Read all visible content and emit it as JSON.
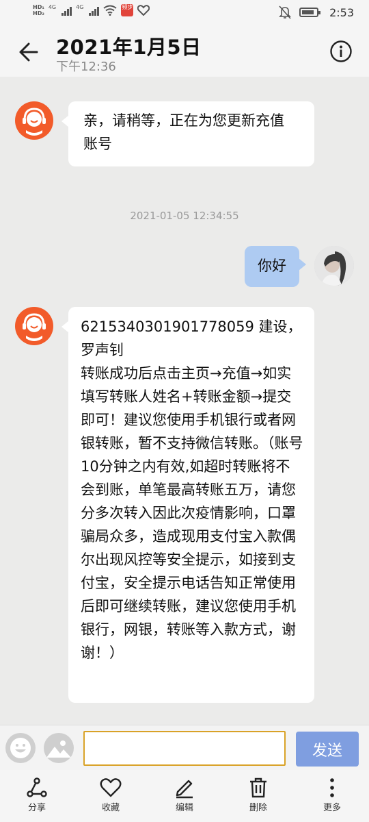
{
  "status_bar": {
    "hd1": "HD₁",
    "hd2": "HD₂",
    "net1": "4G",
    "net2": "4G",
    "badge": "频步",
    "time": "2:53"
  },
  "header": {
    "title": "2021年1月5日",
    "subtitle": "下午12:36"
  },
  "messages": [
    {
      "direction": "incoming",
      "text": "亲，请稍等，正在为您更新充值账号"
    },
    {
      "direction": "timestamp",
      "text": "2021-01-05 12:34:55"
    },
    {
      "direction": "outgoing",
      "text": "你好"
    },
    {
      "direction": "incoming",
      "text": "6215340301901778059 建设，罗声钊\n转账成功后点击主页→充值→如实填写转账人姓名+转账金额→提交即可！建议您使用手机银行或者网银转账，暂不支持微信转账。（账号10分钟之内有效,如超时转账将不会到账，单笔最高转账五万，请您分多次转入因此次疫情影响，口罩骗局众多，造成现用支付宝入款偶尔出现风控等安全提示，如接到支付宝，安全提示电话告知正常使用后即可继续转账，建议您使用手机银行，网银，转账等入款方式，谢谢！）"
    }
  ],
  "input": {
    "value": "",
    "send_label": "发送"
  },
  "toolbar": [
    {
      "label": "分享",
      "icon": "share-icon"
    },
    {
      "label": "收藏",
      "icon": "heart-icon"
    },
    {
      "label": "编辑",
      "icon": "pencil-icon"
    },
    {
      "label": "删除",
      "icon": "trash-icon"
    },
    {
      "label": "更多",
      "icon": "more-vertical-icon"
    }
  ],
  "colors": {
    "accent_orange": "#f25b2a",
    "outgoing_bubble": "#aecbf2",
    "send_button": "#7f9ee0",
    "input_border": "#d9a227",
    "chat_background": "#ebebea"
  }
}
